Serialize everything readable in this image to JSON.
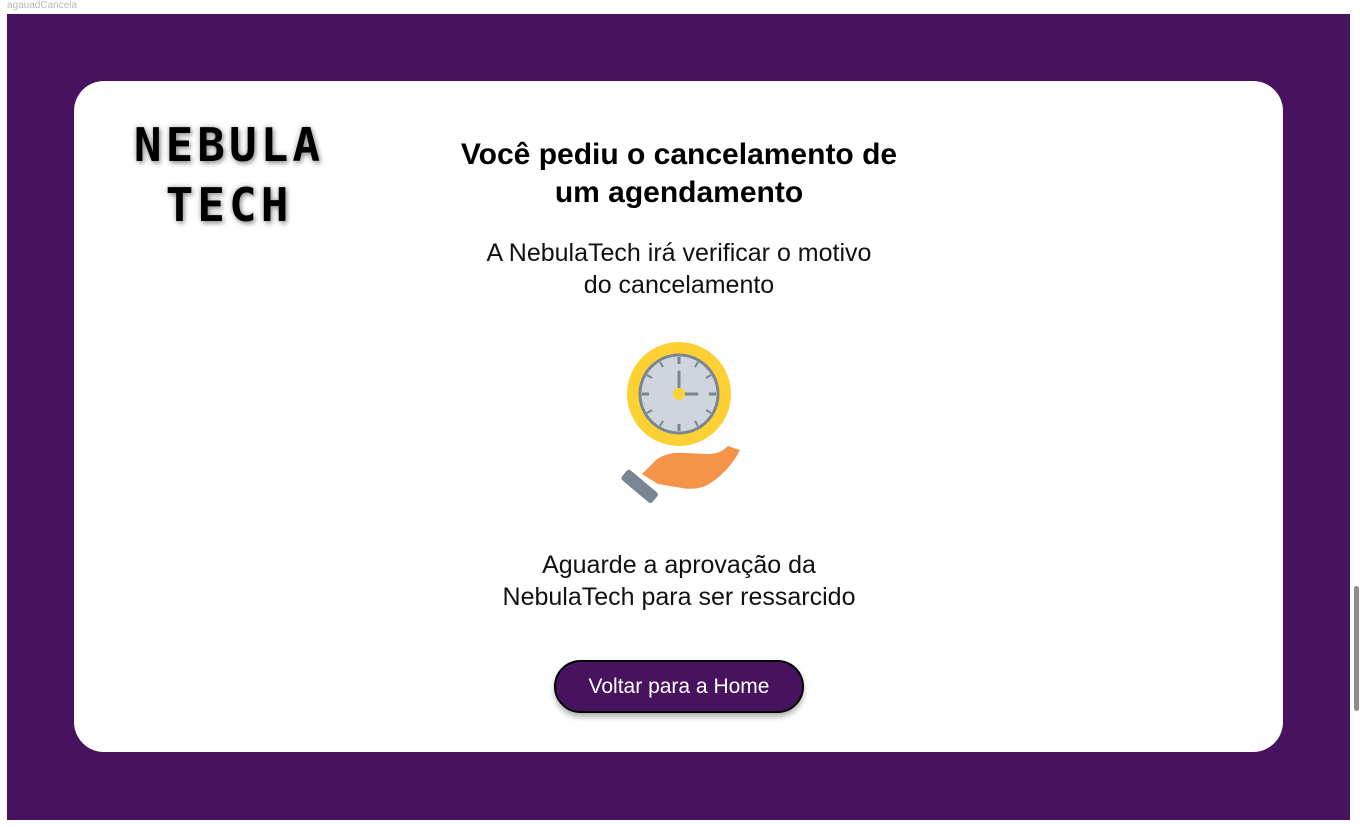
{
  "frame_label": "agauadCancela",
  "logo": {
    "line1": "NEBULA",
    "line2": "TECH"
  },
  "title": {
    "line1": "Você pediu o cancelamento de",
    "line2": "um agendamento"
  },
  "subtitle": {
    "line1": "A NebulaTech irá verificar o motivo",
    "line2": "do cancelamento"
  },
  "illustration_icon": "hand-holding-clock-icon",
  "wait_message": {
    "line1": "Aguarde a aprovação da",
    "line2": "NebulaTech para ser ressarcido"
  },
  "home_button_label": "Voltar para a Home",
  "colors": {
    "background": "#47135e",
    "card": "#ffffff",
    "button": "#47135e",
    "clock_ring": "#fdd033",
    "clock_face": "#cfd5dc",
    "hand": "#f59448",
    "cuff": "#7a8594"
  }
}
